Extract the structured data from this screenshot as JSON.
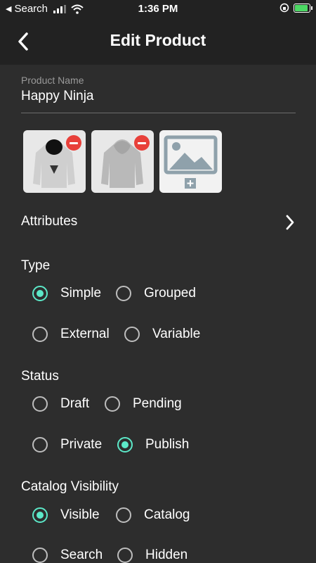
{
  "status_bar": {
    "back_app": "Search",
    "time": "1:36 PM"
  },
  "header": {
    "title": "Edit Product"
  },
  "product_name": {
    "label": "Product Name",
    "value": "Happy Ninja"
  },
  "attributes": {
    "label": "Attributes"
  },
  "type": {
    "title": "Type",
    "options": [
      {
        "label": "Simple",
        "checked": true
      },
      {
        "label": "Grouped",
        "checked": false
      },
      {
        "label": "External",
        "checked": false
      },
      {
        "label": "Variable",
        "checked": false
      }
    ]
  },
  "status": {
    "title": "Status",
    "options": [
      {
        "label": "Draft",
        "checked": false
      },
      {
        "label": "Pending",
        "checked": false
      },
      {
        "label": "Private",
        "checked": false
      },
      {
        "label": "Publish",
        "checked": true
      }
    ]
  },
  "catalog_visibility": {
    "title": "Catalog Visibility",
    "options": [
      {
        "label": "Visible",
        "checked": true
      },
      {
        "label": "Catalog",
        "checked": false
      },
      {
        "label": "Search",
        "checked": false
      },
      {
        "label": "Hidden",
        "checked": false
      }
    ]
  },
  "colors": {
    "accent": "#5ce8c8",
    "remove": "#e8403a",
    "background": "#2d2d2d",
    "header": "#222222"
  },
  "icons": [
    "back-chevron-icon",
    "chevron-right-icon",
    "remove-icon",
    "add-image-icon",
    "wifi-icon",
    "battery-icon"
  ]
}
